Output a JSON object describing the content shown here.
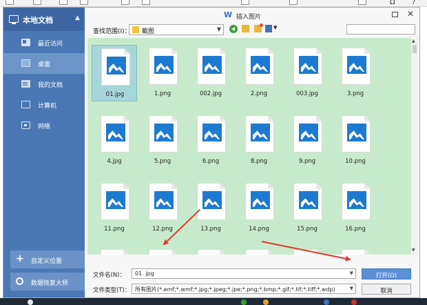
{
  "dialog": {
    "title": "插入图片",
    "title_logo": "W"
  },
  "sidebar": {
    "header": "本地文档",
    "items": [
      {
        "label": "最近访问",
        "icon": "recent-icon",
        "selected": false
      },
      {
        "label": "桌面",
        "icon": "desktop-icon",
        "selected": true
      },
      {
        "label": "我的文档",
        "icon": "documents-icon",
        "selected": false
      },
      {
        "label": "计算机",
        "icon": "computer-icon",
        "selected": false
      },
      {
        "label": "网络",
        "icon": "network-icon",
        "selected": false
      }
    ],
    "custom_location": "自定义位置",
    "data_recovery": "数据恢复大师"
  },
  "lookin": {
    "label": "查找范围(I)：",
    "value": "截图"
  },
  "files": [
    {
      "name": "01.jpg",
      "selected": true
    },
    {
      "name": "1.png",
      "selected": false
    },
    {
      "name": "002.jpg",
      "selected": false
    },
    {
      "name": "2.png",
      "selected": false
    },
    {
      "name": "003.jpg",
      "selected": false
    },
    {
      "name": "3.png",
      "selected": false
    },
    {
      "name": "4.jpg",
      "selected": false
    },
    {
      "name": "5.png",
      "selected": false
    },
    {
      "name": "6.png",
      "selected": false
    },
    {
      "name": "8.png",
      "selected": false
    },
    {
      "name": "9.png",
      "selected": false
    },
    {
      "name": "10.png",
      "selected": false
    },
    {
      "name": "11.png",
      "selected": false
    },
    {
      "name": "12.png",
      "selected": false
    },
    {
      "name": "13.png",
      "selected": false
    },
    {
      "name": "14.png",
      "selected": false
    },
    {
      "name": "15.png",
      "selected": false
    },
    {
      "name": "16.png",
      "selected": false
    },
    {
      "name": "",
      "selected": false
    },
    {
      "name": "",
      "selected": false
    },
    {
      "name": "",
      "selected": false
    },
    {
      "name": "",
      "selected": false
    },
    {
      "name": "",
      "selected": false
    },
    {
      "name": "",
      "selected": false
    }
  ],
  "bottom": {
    "filename_label": "文件名(N)：",
    "filename_value": "01. jpg",
    "filetype_label": "文件类型(T)：",
    "filetype_value": "所有图片(*.emf;*.wmf;*.jpg;*.jpeg;*.jpe;*.png;*.bmp;*.gif;*.tif;*.tiff;*.wdp)",
    "open_button": "打开(O)",
    "cancel_button": "取消"
  },
  "app_toolbar": {
    "formula_glyph": "Ω",
    "help_glyph": "?"
  },
  "colors": {
    "sidebar": "#4a78b5",
    "file_area": "#c8eacc",
    "accent": "#1e7ad1",
    "arrow": "#e03a2f",
    "primary_button": "#5b8fd6"
  }
}
